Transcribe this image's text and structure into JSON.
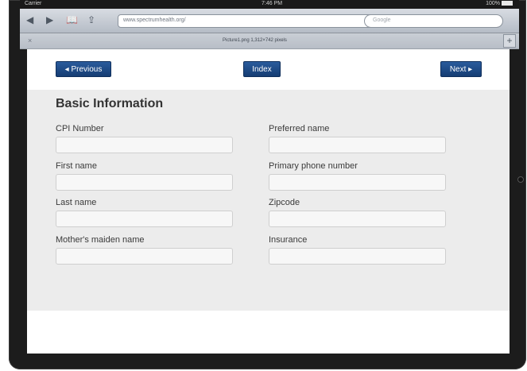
{
  "status_bar": {
    "carrier": "Carrier",
    "time": "7:46 PM",
    "battery": "100%"
  },
  "browser": {
    "url": "www.spectrumhealth.org/",
    "search_placeholder": "Google",
    "tab_title": "Picture1.png 1,312×742 pixels",
    "icons": [
      "back-icon",
      "forward-icon",
      "bookmarks-icon",
      "share-icon",
      "reload-icon",
      "close-tab-icon",
      "add-tab-icon"
    ]
  },
  "nav": {
    "previous": "◂ Previous",
    "index": "Index",
    "next": "Next ▸"
  },
  "form": {
    "title": "Basic Information",
    "fields": [
      {
        "label": "CPI Number",
        "value": ""
      },
      {
        "label": "Preferred name",
        "value": ""
      },
      {
        "label": "First name",
        "value": ""
      },
      {
        "label": "Primary phone number",
        "value": ""
      },
      {
        "label": "Last name",
        "value": ""
      },
      {
        "label": "Zipcode",
        "value": ""
      },
      {
        "label": "Mother's maiden name",
        "value": ""
      },
      {
        "label": "Insurance",
        "value": ""
      }
    ]
  },
  "colors": {
    "button": "#1f4c87",
    "form_bg": "#ececec",
    "device": "#1c1c1c"
  }
}
